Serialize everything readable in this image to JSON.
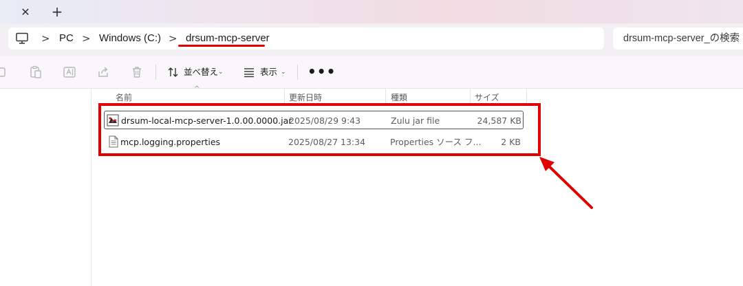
{
  "tabs": {
    "close_glyph": "✕",
    "add_glyph": "+"
  },
  "address": {
    "breadcrumbs": [
      {
        "label": "PC"
      },
      {
        "label": "Windows (C:)"
      },
      {
        "label": "drsum-mcp-server"
      }
    ],
    "separator": ">",
    "search_placeholder": "drsum-mcp-server_の検索"
  },
  "toolbar": {
    "sort_label": "並べ替え",
    "view_label": "表示",
    "more_label": "•••",
    "icons": [
      "copy-icon",
      "paste-icon",
      "rename-icon",
      "share-icon",
      "delete-icon",
      "sort-icon",
      "view-icon"
    ]
  },
  "columns": {
    "name": "名前",
    "modified": "更新日時",
    "type": "種類",
    "size": "サイズ"
  },
  "files": [
    {
      "name": "drsum-local-mcp-server-1.0.00.0000.jar",
      "modified": "2025/08/29 9:43",
      "type": "Zulu jar file",
      "size": "24,587 KB",
      "icon": "jar-file-icon",
      "selected": true
    },
    {
      "name": "mcp.logging.properties",
      "modified": "2025/08/27 13:34",
      "type": "Properties ソース フ...",
      "size": "2 KB",
      "icon": "text-file-icon",
      "selected": false
    }
  ],
  "colors": {
    "annotation_red": "#e00000",
    "background": "#ffffff",
    "address_row": "#f3f0f3"
  }
}
